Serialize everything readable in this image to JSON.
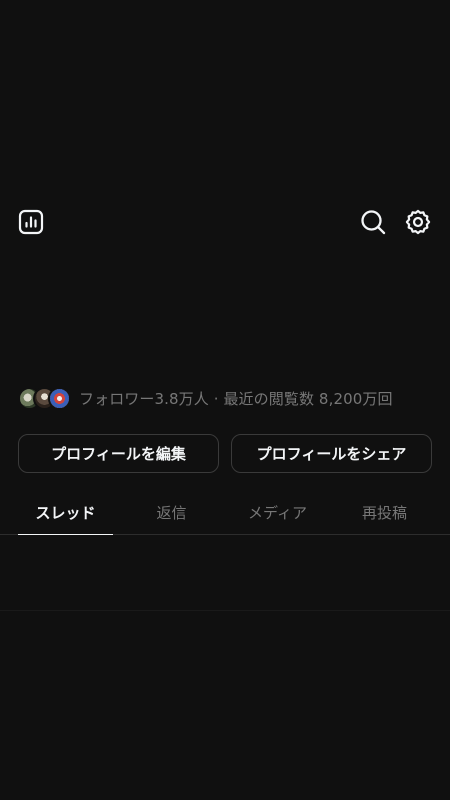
{
  "header": {
    "insights_icon": "bar-chart-icon",
    "search_icon": "search-icon",
    "settings_icon": "gear-icon"
  },
  "profile": {
    "followers_line": "フォロワー3.8万人 · 最近の閲覧数 8,200万回",
    "edit_button": "プロフィールを編集",
    "share_button": "プロフィールをシェア"
  },
  "tabs": [
    {
      "label": "スレッド",
      "active": true
    },
    {
      "label": "返信",
      "active": false
    },
    {
      "label": "メディア",
      "active": false
    },
    {
      "label": "再投稿",
      "active": false
    }
  ],
  "colors": {
    "background": "#101010",
    "text_primary": "#f3f5f7",
    "text_secondary": "#777777",
    "border": "#3a3a3a"
  }
}
